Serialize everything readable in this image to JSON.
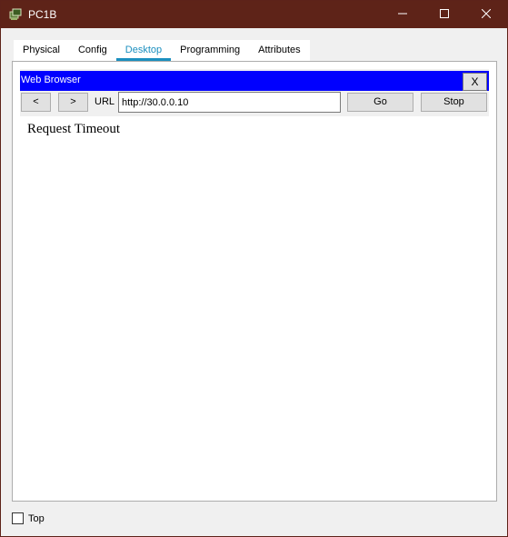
{
  "window": {
    "title": "PC1B",
    "icon": "packet-tracer-pc-icon",
    "controls": {
      "minimize": "minimize-icon",
      "maximize": "maximize-icon",
      "close": "close-icon"
    }
  },
  "tabs": [
    {
      "label": "Physical",
      "active": false
    },
    {
      "label": "Config",
      "active": false
    },
    {
      "label": "Desktop",
      "active": true
    },
    {
      "label": "Programming",
      "active": false
    },
    {
      "label": "Attributes",
      "active": false
    }
  ],
  "browser": {
    "title": "Web Browser",
    "close_label": "X",
    "back_label": "<",
    "forward_label": ">",
    "url_label": "URL",
    "url_value": "http://30.0.0.10",
    "go_label": "Go",
    "stop_label": "Stop",
    "page_message": "Request Timeout"
  },
  "footer": {
    "top_label": "Top",
    "top_checked": false
  },
  "colors": {
    "titlebar": "#5e2318",
    "browser_titlebar": "#0000ff",
    "active_tab": "#1b8fbf"
  }
}
